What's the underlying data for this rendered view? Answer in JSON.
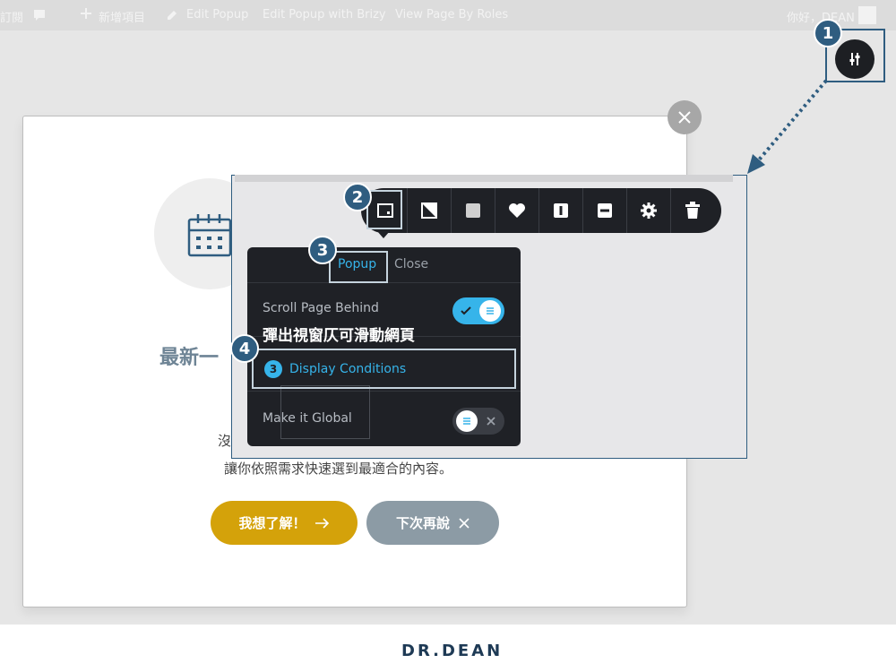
{
  "admin_bar": {
    "items": [
      "訂閱",
      "",
      "新增項目",
      "Edit Popup",
      "Edit Popup with Brizy",
      "View Page By Roles"
    ],
    "greeting": "你好，DEAN"
  },
  "popup": {
    "heading": "最新一",
    "body_line1": "沒",
    "body_line2": "讓你依照需求快速選到最適合的內容。",
    "primary_button": "我想了解！",
    "secondary_button": "下次再說"
  },
  "callouts": [
    "1",
    "2",
    "3",
    "4"
  ],
  "toolbar": {
    "icons": [
      "popup-settings-icon",
      "contrast-icon",
      "square-icon",
      "heart-icon",
      "column-icon",
      "row-icon",
      "gear-icon",
      "trash-icon"
    ]
  },
  "dropdown": {
    "tabs": [
      "Popup",
      "Close"
    ],
    "active_tab": "Popup",
    "scroll_label": "Scroll Page Behind",
    "scroll_enabled": true,
    "overlay_caption": "彈出視窗仄可滑動網頁",
    "display_conditions_count": "3",
    "display_conditions_label": "Display Conditions",
    "global_label": "Make it Global",
    "global_enabled": false
  },
  "footer": {
    "logo": "DR.DEAN"
  },
  "colors": {
    "accent": "#36b4ea",
    "callout": "#2f5d80",
    "primary_button": "#d4a20a",
    "secondary_button": "#8c9ba5",
    "toolbar_bg": "#1f2126"
  }
}
